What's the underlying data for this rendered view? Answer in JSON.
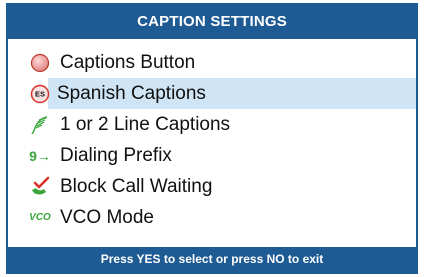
{
  "header": {
    "title": "CAPTION SETTINGS"
  },
  "menu": {
    "items": [
      {
        "label": "Captions Button",
        "icon": "record-button-icon"
      },
      {
        "label": "Spanish Captions",
        "icon": "es-badge-icon",
        "badge": "ES",
        "selected": true
      },
      {
        "label": "1 or 2 Line Captions",
        "icon": "feather-icon"
      },
      {
        "label": "Dialing Prefix",
        "icon": "nine-arrow-icon",
        "glyph": "9→"
      },
      {
        "label": "Block Call Waiting",
        "icon": "phone-check-icon"
      },
      {
        "label": "VCO Mode",
        "icon": "vco-icon",
        "glyph": "VCO"
      }
    ]
  },
  "footer": {
    "hint": "Press YES to select or press NO to exit"
  },
  "colors": {
    "brand": "#1e5a93",
    "highlight": "#cfe5f6",
    "accent_green": "#3aa63a",
    "red": "#d9342b"
  }
}
